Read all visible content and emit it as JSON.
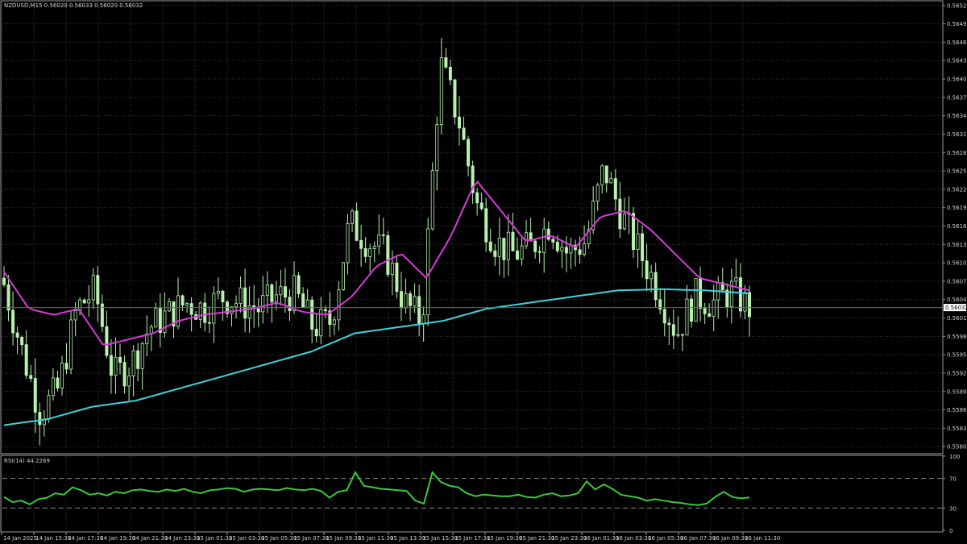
{
  "main_header": "NZDUSD,M15  0.56020 0.56033 0.56020 0.56032",
  "rsi_header": "RSI(14) 44.2269",
  "current_price_label": "0.56032",
  "colors": {
    "background": "#000000",
    "grid": "#3a3a3a",
    "candle": "#b9f0b0",
    "ma_fast": "#d63ad6",
    "ma_slow": "#3fd3dc",
    "rsi_line": "#39c939",
    "rsi_levels": "#8a8a8a"
  },
  "chart_data": [
    {
      "type": "candlestick",
      "symbol": "NZDUSD",
      "timeframe": "M15",
      "y_ticks": [
        "0.56525",
        "0.56495",
        "0.56465",
        "0.56435",
        "0.56405",
        "0.56375",
        "0.56345",
        "0.56315",
        "0.56285",
        "0.56255",
        "0.56225",
        "0.56195",
        "0.56165",
        "0.56135",
        "0.56105",
        "0.56075",
        "0.56045",
        "0.56015",
        "0.55985",
        "0.55955",
        "0.55925",
        "0.55895",
        "0.55865",
        "0.55835",
        "0.55805"
      ],
      "ylim": [
        0.558,
        0.5653
      ],
      "x_ticks": [
        "14 Jan 2025",
        "14 Jan 15:30",
        "14 Jan 17:30",
        "14 Jan 19:30",
        "14 Jan 21:30",
        "14 Jan 23:30",
        "15 Jan 01:30",
        "15 Jan 03:30",
        "15 Jan 05:30",
        "15 Jan 07:30",
        "15 Jan 09:30",
        "15 Jan 11:30",
        "15 Jan 13:30",
        "15 Jan 15:30",
        "15 Jan 17:30",
        "15 Jan 19:30",
        "15 Jan 21:30",
        "15 Jan 23:30",
        "16 Jan 01:30",
        "16 Jan 03:30",
        "16 Jan 05:30",
        "16 Jan 07:30",
        "16 Jan 09:30",
        "16 Jan 11:30"
      ],
      "close_anchors": [
        0.5607,
        0.5596,
        0.5586,
        0.559,
        0.5603,
        0.5606,
        0.5592,
        0.5594,
        0.56,
        0.5602,
        0.5604,
        0.5603,
        0.5605,
        0.5604,
        0.5603,
        0.5605,
        0.56055,
        0.56,
        0.5601,
        0.5617,
        0.5614,
        0.5612,
        0.5604,
        0.5601,
        0.5643,
        0.5634,
        0.562,
        0.5614,
        0.5612,
        0.5613,
        0.5617,
        0.5612,
        0.5614,
        0.5626,
        0.5618,
        0.5612,
        0.5606,
        0.5599,
        0.5605,
        0.5604,
        0.5606,
        0.56032
      ],
      "ma_fast_anchors": [
        0.5609,
        0.5603,
        0.5602,
        0.5603,
        0.5597,
        0.5598,
        0.5599,
        0.5601,
        0.5602,
        0.56025,
        0.5603,
        0.5604,
        0.56025,
        0.5602,
        0.5605,
        0.561,
        0.5612,
        0.5608,
        0.5615,
        0.5624,
        0.5619,
        0.5614,
        0.5615,
        0.5613,
        0.5618,
        0.5619,
        0.5616,
        0.5612,
        0.5608,
        0.5607,
        0.5606
      ],
      "ma_slow_anchors": [
        0.5584,
        0.5585,
        0.5587,
        0.5588,
        0.559,
        0.5592,
        0.5594,
        0.5596,
        0.5599,
        0.56,
        0.5601,
        0.5603,
        0.5604,
        0.5605,
        0.5606,
        0.56062,
        0.5606,
        0.56055
      ],
      "last_price": 0.56032,
      "grid": true
    },
    {
      "type": "line",
      "indicator": "RSI",
      "period": 14,
      "value": 44.2269,
      "y_ticks": [
        "100",
        "70",
        "30",
        "0"
      ],
      "levels": [
        70,
        30
      ],
      "ylim": [
        0,
        100
      ],
      "values": [
        45,
        38,
        40,
        35,
        42,
        44,
        50,
        48,
        58,
        54,
        48,
        50,
        47,
        52,
        50,
        54,
        55,
        53,
        52,
        55,
        53,
        56,
        52,
        50,
        54,
        55,
        57,
        56,
        52,
        55,
        56,
        55,
        54,
        57,
        55,
        54,
        56,
        53,
        44,
        52,
        54,
        78,
        60,
        58,
        56,
        55,
        54,
        53,
        40,
        36,
        78,
        65,
        60,
        58,
        50,
        46,
        48,
        47,
        46,
        46,
        48,
        45,
        44,
        48,
        50,
        46,
        47,
        50,
        66,
        55,
        62,
        56,
        48,
        46,
        44,
        40,
        42,
        40,
        38,
        37,
        35,
        34,
        36,
        45,
        52,
        45,
        43,
        44.2269
      ],
      "grid": true
    }
  ]
}
